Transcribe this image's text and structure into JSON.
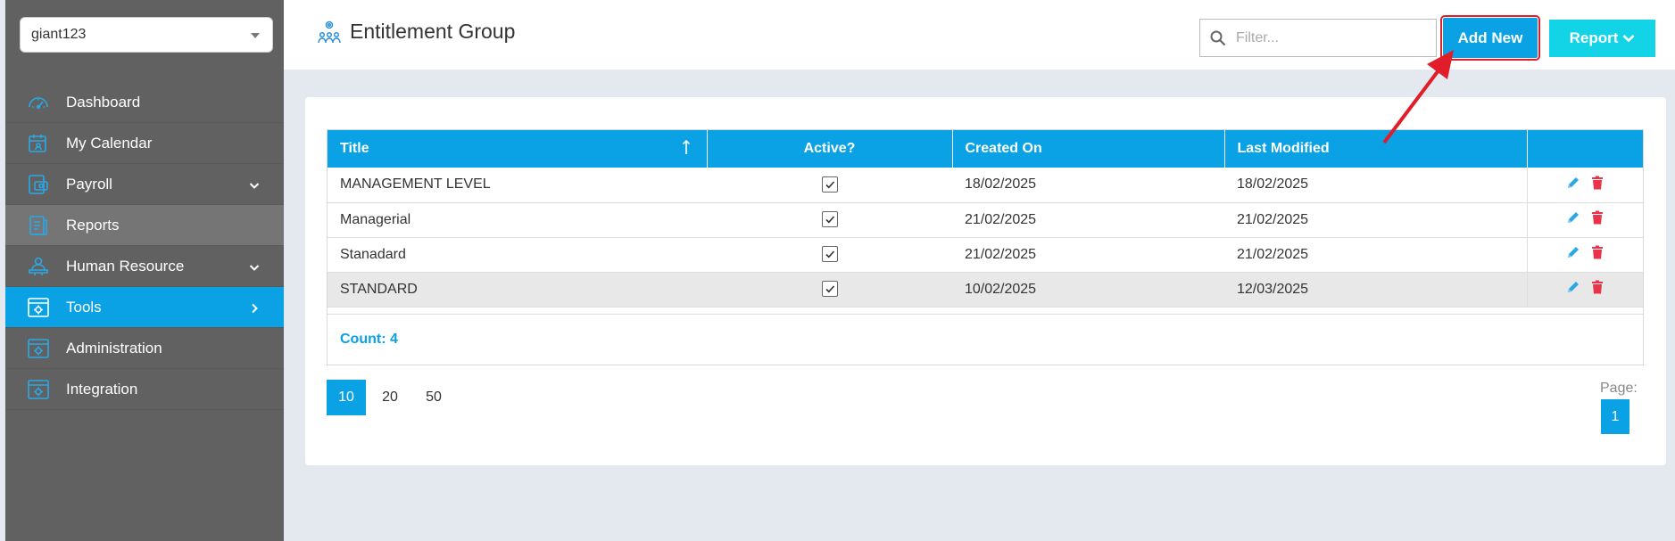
{
  "sidebar": {
    "company": "giant123",
    "items": [
      {
        "label": "Dashboard",
        "icon": "dashboard-icon",
        "has_children": false,
        "state": "normal"
      },
      {
        "label": "My Calendar",
        "icon": "calendar-icon",
        "has_children": false,
        "state": "normal"
      },
      {
        "label": "Payroll",
        "icon": "payroll-icon",
        "has_children": true,
        "state": "normal"
      },
      {
        "label": "Reports",
        "icon": "reports-icon",
        "has_children": false,
        "state": "hover"
      },
      {
        "label": "Human Resource",
        "icon": "human-resource-icon",
        "has_children": true,
        "state": "normal"
      },
      {
        "label": "Tools",
        "icon": "tools-icon",
        "has_children": true,
        "state": "active"
      },
      {
        "label": "Administration",
        "icon": "administration-icon",
        "has_children": false,
        "state": "normal"
      },
      {
        "label": "Integration",
        "icon": "integration-icon",
        "has_children": false,
        "state": "normal"
      }
    ]
  },
  "header": {
    "title": "Entitlement Group",
    "filter_placeholder": "Filter...",
    "add_label": "Add New",
    "report_label": "Report"
  },
  "table": {
    "columns": [
      "Title",
      "Active?",
      "Created On",
      "Last Modified",
      ""
    ],
    "rows": [
      {
        "title": "MANAGEMENT LEVEL",
        "active": true,
        "created": "18/02/2025",
        "modified": "18/02/2025"
      },
      {
        "title": "Managerial",
        "active": true,
        "created": "21/02/2025",
        "modified": "21/02/2025"
      },
      {
        "title": "Stanadard",
        "active": true,
        "created": "21/02/2025",
        "modified": "21/02/2025"
      },
      {
        "title": "STANDARD",
        "active": true,
        "created": "10/02/2025",
        "modified": "12/03/2025",
        "selected": true
      }
    ],
    "count_label": "Count: 4"
  },
  "pagination": {
    "sizes": [
      "10",
      "20",
      "50"
    ],
    "active_size": "10",
    "page_label": "Page:",
    "current_page": "1"
  },
  "colors": {
    "primary": "#0aa2e4",
    "report": "#12d4e6",
    "sidebar": "#616161",
    "delete": "#e8334a",
    "annotation": "#e11d2a"
  }
}
